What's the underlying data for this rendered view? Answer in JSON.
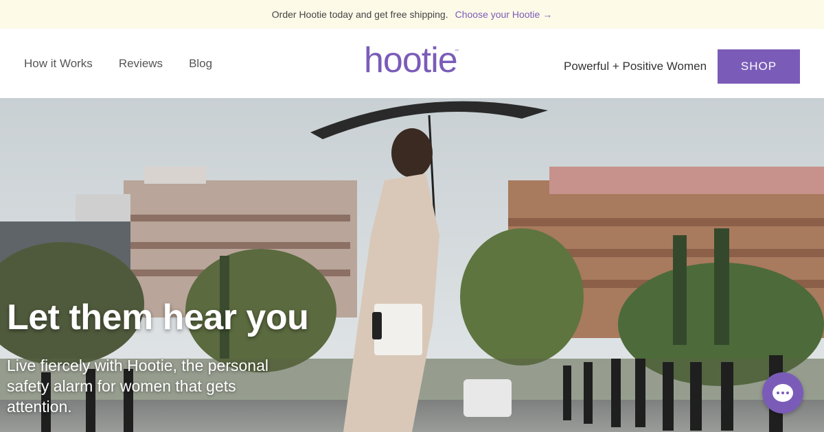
{
  "announcement": {
    "text": "Order Hootie today and get free shipping.",
    "link_label": "Choose your Hootie →"
  },
  "header": {
    "nav": [
      {
        "label": "How it Works"
      },
      {
        "label": "Reviews"
      },
      {
        "label": "Blog"
      }
    ],
    "logo_text": "hootie",
    "logo_tm": "™",
    "tagline": "Powerful + Positive Women",
    "shop_label": "SHOP"
  },
  "hero": {
    "title": "Let them hear you",
    "subtitle": "Live fiercely with Hootie, the personal safety alarm for women that gets attention."
  },
  "chat": {
    "icon": "chat-icon"
  },
  "colors": {
    "brand": "#7a5cb8",
    "announcement_bg": "#fdfae8"
  }
}
